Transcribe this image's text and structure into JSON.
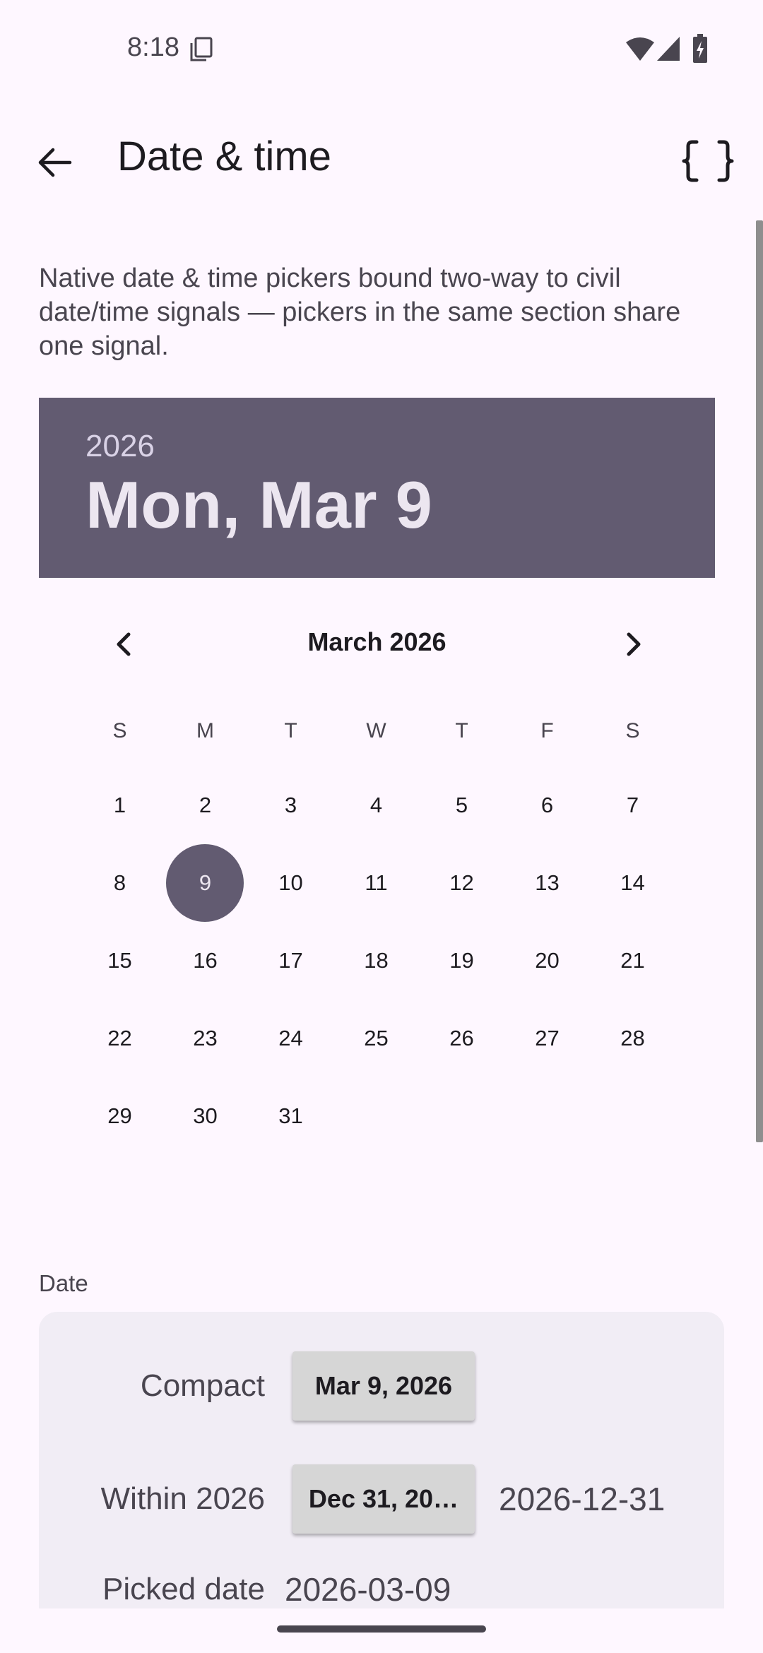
{
  "status_bar": {
    "time": "8:18"
  },
  "app_bar": {
    "title": "Date & time"
  },
  "description": "Native date & time pickers bound two-way to civil date/time signals — pickers in the same section share one signal.",
  "date_picker": {
    "year": "2026",
    "selected_date": "Mon, Mar 9",
    "month_label": "March 2026",
    "weekdays": [
      "S",
      "M",
      "T",
      "W",
      "T",
      "F",
      "S"
    ],
    "days": [
      "1",
      "2",
      "3",
      "4",
      "5",
      "6",
      "7",
      "8",
      "9",
      "10",
      "11",
      "12",
      "13",
      "14",
      "15",
      "16",
      "17",
      "18",
      "19",
      "20",
      "21",
      "22",
      "23",
      "24",
      "25",
      "26",
      "27",
      "28",
      "29",
      "30",
      "31"
    ],
    "selected_day": "9",
    "accent_color": "#625B71"
  },
  "date_section": {
    "label": "Date",
    "compact": {
      "label": "Compact",
      "value": "Mar 9, 2026"
    },
    "within": {
      "label": "Within 2026",
      "value": "Dec 31, 20…",
      "iso": "2026-12-31"
    },
    "picked": {
      "label": "Picked date",
      "value": "2026-03-09"
    }
  }
}
